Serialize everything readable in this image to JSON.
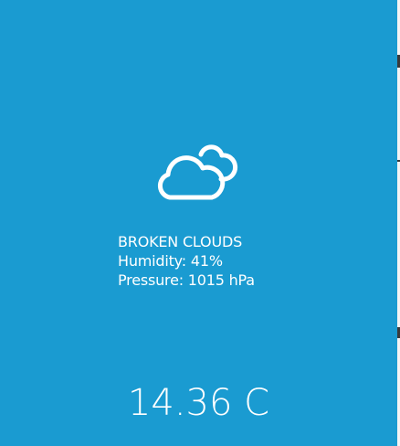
{
  "weather": {
    "icon": "broken-clouds-icon",
    "description": "BROKEN CLOUDS",
    "humidity": "Humidity: 41%",
    "pressure": "Pressure: 1015 hPa",
    "temperature": "14.36 C"
  },
  "colors": {
    "background": "#1a9bd1",
    "text": "#ffffff"
  }
}
